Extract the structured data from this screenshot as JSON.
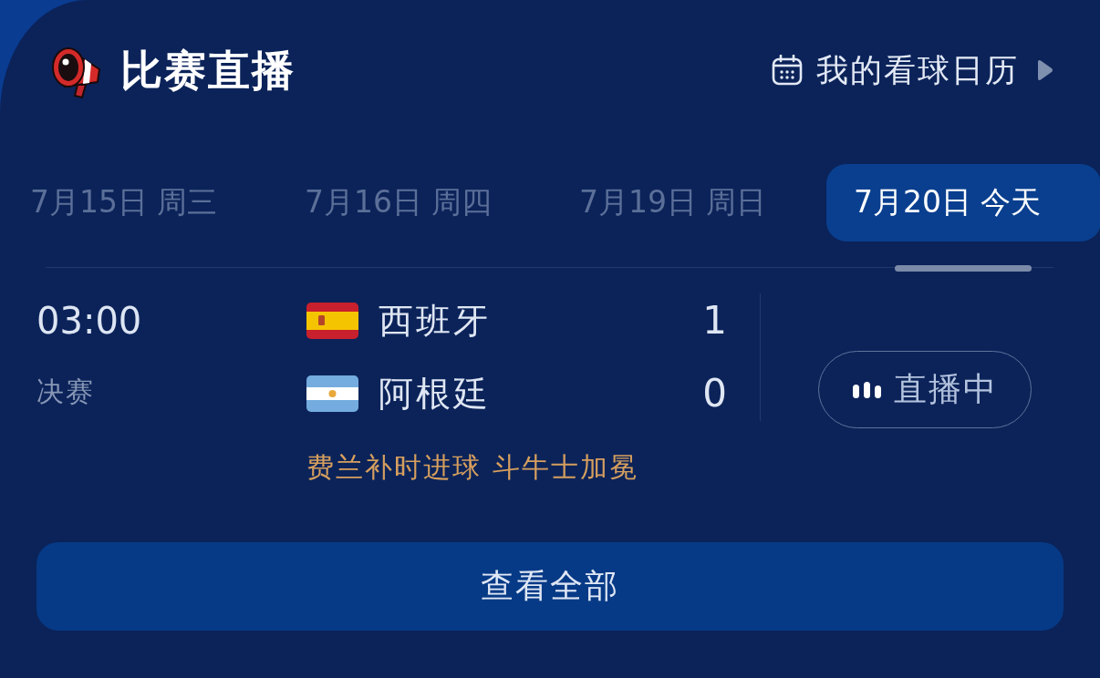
{
  "header": {
    "title": "比赛直播",
    "calendar_link": "我的看球日历"
  },
  "date_tabs": [
    {
      "label": "7月15日 周三",
      "selected": false
    },
    {
      "label": "7月16日 周四",
      "selected": false
    },
    {
      "label": "7月19日 周日",
      "selected": false
    },
    {
      "label": "7月20日 今天",
      "selected": true
    }
  ],
  "matches": [
    {
      "time": "03:00",
      "stage": "决赛",
      "teams": [
        {
          "kind": "spain",
          "name": "西班牙",
          "score": "1"
        },
        {
          "kind": "argentina",
          "name": "阿根廷",
          "score": "0"
        }
      ],
      "note": "费兰补时进球 斗牛士加冕",
      "status": "直播中"
    }
  ],
  "view_all": "查看全部"
}
